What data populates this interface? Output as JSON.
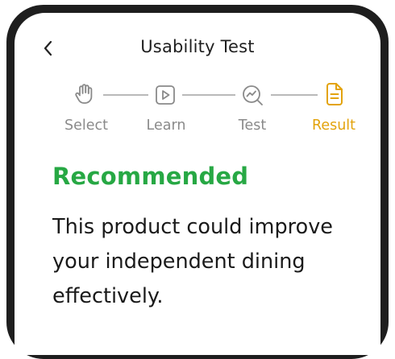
{
  "header": {
    "back_icon": "chevron-left-icon",
    "title": "Usability Test"
  },
  "steps": [
    {
      "label": "Select",
      "icon": "hand-icon",
      "state": "done"
    },
    {
      "label": "Learn",
      "icon": "play-icon",
      "state": "done"
    },
    {
      "label": "Test",
      "icon": "chart-search-icon",
      "state": "done"
    },
    {
      "label": "Result",
      "icon": "document-icon",
      "state": "active"
    }
  ],
  "colors": {
    "accent": "#e3a30c",
    "inactive": "#8a8a8a",
    "recommended": "#27a844"
  },
  "result": {
    "status": "Recommended",
    "message": "This product could improve your independent dining effectively."
  }
}
